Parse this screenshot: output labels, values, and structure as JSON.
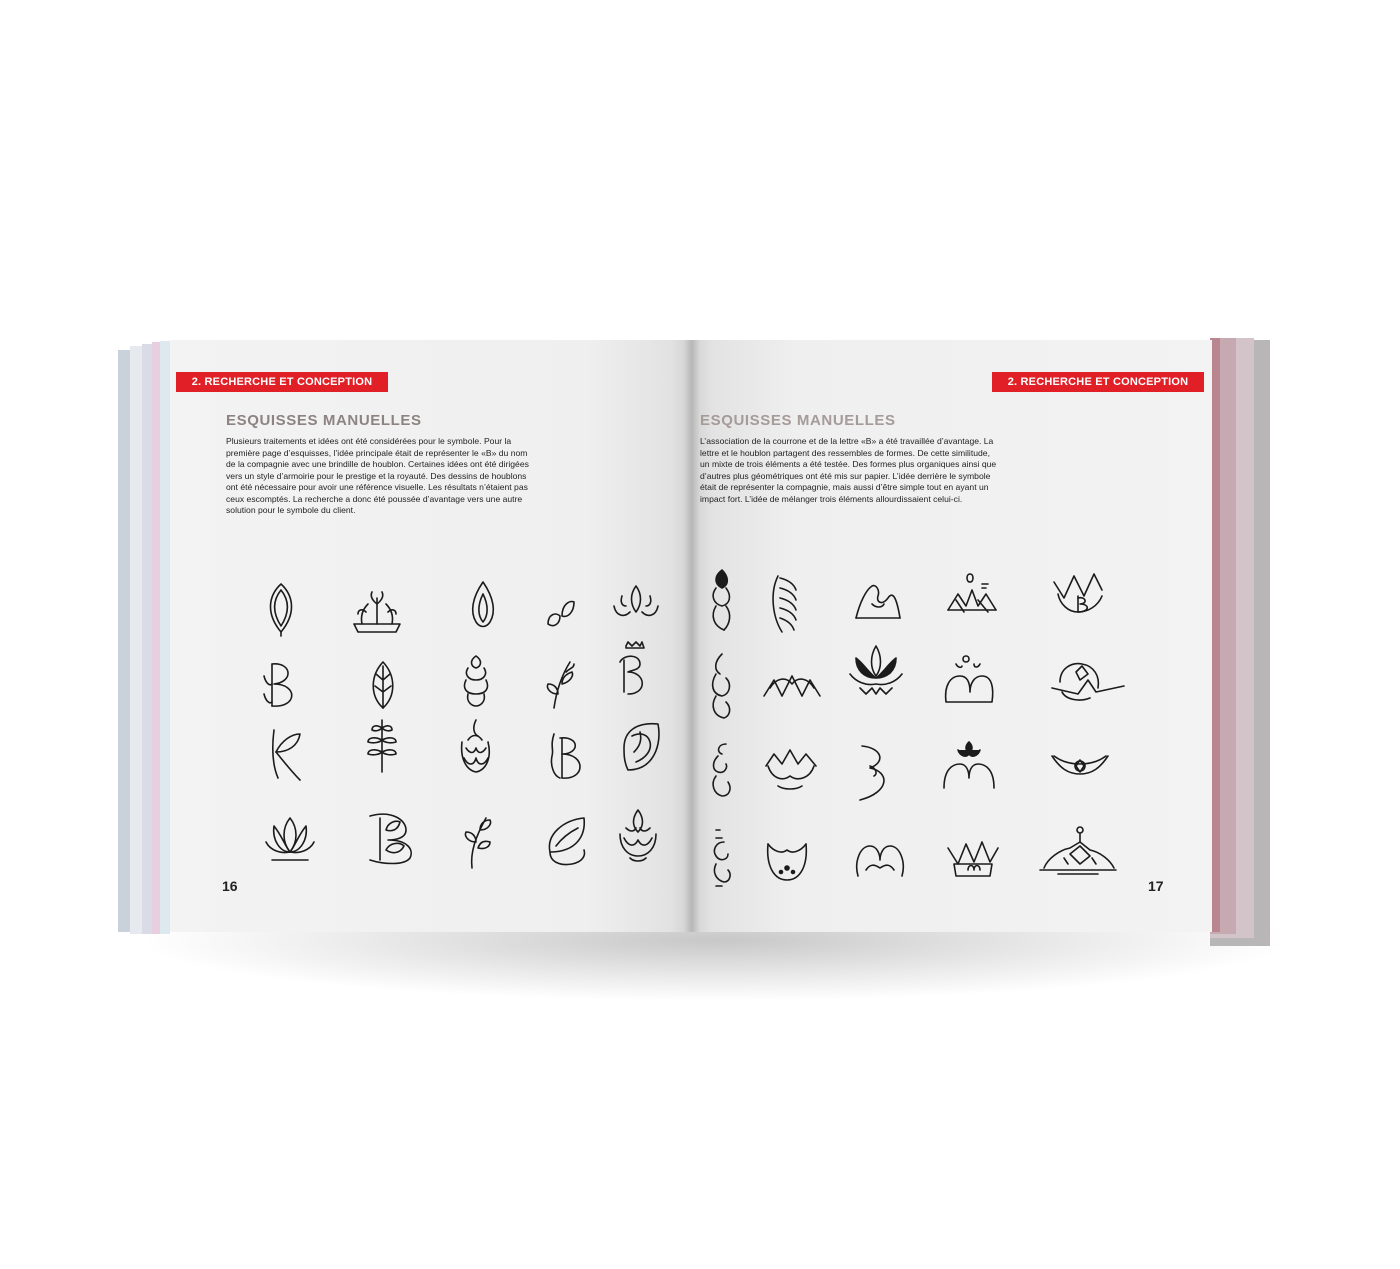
{
  "left_page": {
    "chapter_tag": "2. Recherche et conception",
    "section_title": "Esquisses manuelles",
    "body": "Plusieurs traitements et idées ont été considérées pour le symbole. Pour la première page d’esquisses, l’idée principale était de représenter le «B» du nom de la compagnie avec une brindille de houblon. Certaines idées ont été dirigées vers un style d’armoirie pour le prestige et la royauté. Des dessins de houblons ont été nécessaire pour avoir une référence visuelle. Les résultats n’étaient pas ceux escomptés. La recherche a donc été poussée d’avantage vers une autre solution pour le symbole du client.",
    "page_number": "16"
  },
  "right_page": {
    "chapter_tag": "2. Recherche et conception",
    "section_title": "Esquisses manuelles",
    "body": "L’association de la courrone et de la lettre «B» a été travaillée d’avantage. La lettre et le houblon partagent des ressembles de formes. De cette similitude, un mixte de trois éléments a été testée. Des formes plus organiques ainsi que d’autres plus géométriques ont été mis sur papier. L’idée derrière le symbole était de représenter la compagnie, mais aussi d’être simple tout en ayant un impact fort. L’idée de mélanger trois éléments allourdissaient celui-ci.",
    "page_number": "17"
  },
  "colors": {
    "accent": "#e01f26",
    "page": "#f1f1f1",
    "ink": "#1b1b1b",
    "title_gray": "#8d8482"
  },
  "sketch_icons": {
    "left": [
      "hop-leaf-icon",
      "crown-wheat-icon",
      "hop-flame-icon",
      "sprout-icon",
      "crown-leaves-icon",
      "leaf-b-icon",
      "hop-leaf-outline-icon",
      "hop-cone-icon",
      "branch-icon",
      "crowned-b-icon",
      "leaf-k-icon",
      "wheat-branch-icon",
      "hop-flame-tall-icon",
      "stylized-b-icon",
      "leaf-shield-icon",
      "lotus-icon",
      "b-leaf-icon",
      "vine-icon",
      "leaf-cup-icon",
      "flame-hop-icon"
    ],
    "right": [
      "hop-stack-icon",
      "hop-ribs-icon",
      "m-crown-icon",
      "wheat-crown-b-icon",
      "crown-b-icon",
      "hop-curve-icon",
      "zigzag-crown-icon",
      "lotus-crown-icon",
      "b-loaf-icon",
      "compass-a-icon",
      "curl-hop-icon",
      "lotus-bowl-icon",
      "b-arc-icon",
      "m-tiara-icon",
      "flat-crown-icon",
      "spiral-hop-icon",
      "bowl-face-icon",
      "m-wave-icon",
      "crown-m-icon",
      "b-mountain-icon"
    ]
  }
}
